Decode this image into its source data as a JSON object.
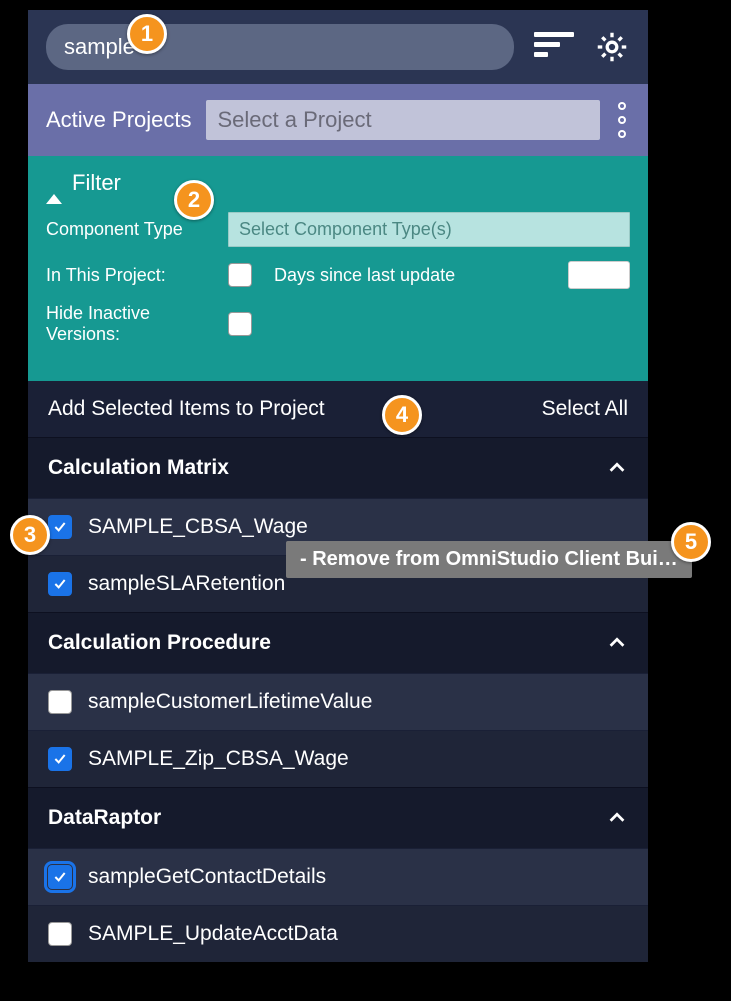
{
  "header": {
    "search_value": "sample"
  },
  "project": {
    "label": "Active Projects",
    "placeholder": "Select a Project"
  },
  "filter": {
    "title": "Filter",
    "component_type_label": "Component Type",
    "component_type_placeholder": "Select Component Type(s)",
    "in_project_label": "In This Project:",
    "days_label": "Days since last update",
    "hide_inactive_label": "Hide Inactive Versions:"
  },
  "actions": {
    "add_label": "Add Selected Items to Project",
    "select_all_label": "Select All"
  },
  "groups": [
    {
      "title": "Calculation Matrix",
      "items": [
        {
          "label": "SAMPLE_CBSA_Wage",
          "checked": true
        },
        {
          "label": "sampleSLARetention",
          "checked": true
        }
      ]
    },
    {
      "title": "Calculation Procedure",
      "items": [
        {
          "label": "sampleCustomerLifetimeValue",
          "checked": false
        },
        {
          "label": "SAMPLE_Zip_CBSA_Wage",
          "checked": true
        }
      ]
    },
    {
      "title": "DataRaptor",
      "items": [
        {
          "label": "sampleGetContactDetails",
          "checked": true,
          "focus": true
        },
        {
          "label": "SAMPLE_UpdateAcctData",
          "checked": false
        }
      ]
    }
  ],
  "tooltip": " - Remove from OmniStudio Client Bui…",
  "callouts": [
    "1",
    "2",
    "3",
    "4",
    "5"
  ]
}
